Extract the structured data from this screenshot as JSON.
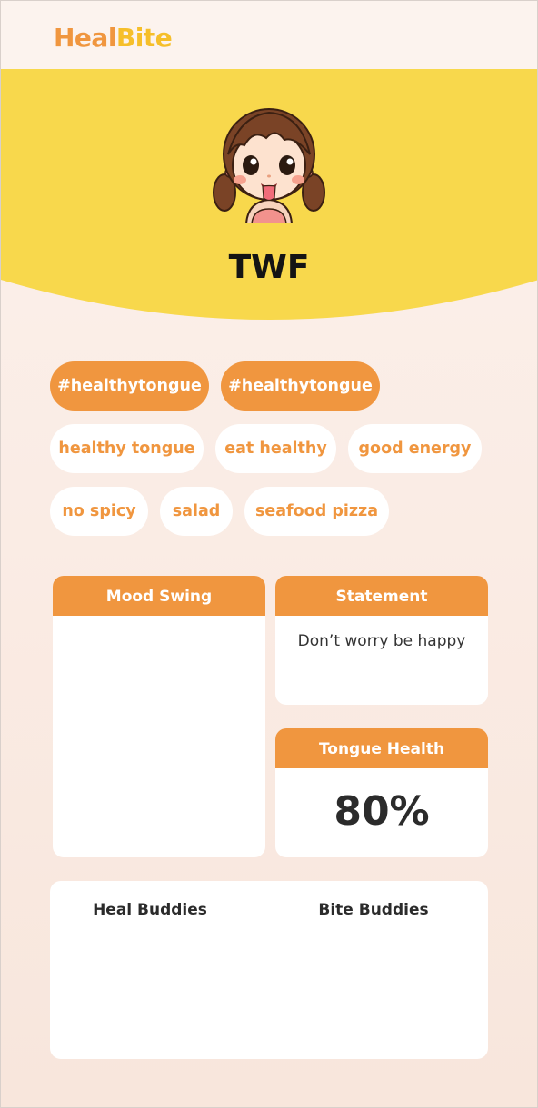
{
  "app": {
    "logo_part1": "Heal",
    "logo_part2": "Bite"
  },
  "profile": {
    "name": "TWF",
    "avatar_icon": "girl-tongue-avatar-icon"
  },
  "tags": {
    "primary": [
      "#healthytongue",
      "#healthytongue"
    ],
    "secondary": [
      "healthy tongue",
      "eat healthy",
      "good energy",
      "no spicy",
      "salad",
      "seafood pizza"
    ]
  },
  "cards": {
    "mood_swing": {
      "title": "Mood Swing"
    },
    "statement": {
      "title": "Statement",
      "text": "Don’t worry be happy"
    },
    "tongue_health": {
      "title": "Tongue Health",
      "value": "80%"
    }
  },
  "buddies": {
    "heal_label": "Heal Buddies",
    "bite_label": "Bite Buddies"
  },
  "colors": {
    "accent": "#f0963f",
    "hero_yellow": "#f8d84c",
    "logo_yellow": "#f6bf2a",
    "background": "#f9e9e0"
  }
}
